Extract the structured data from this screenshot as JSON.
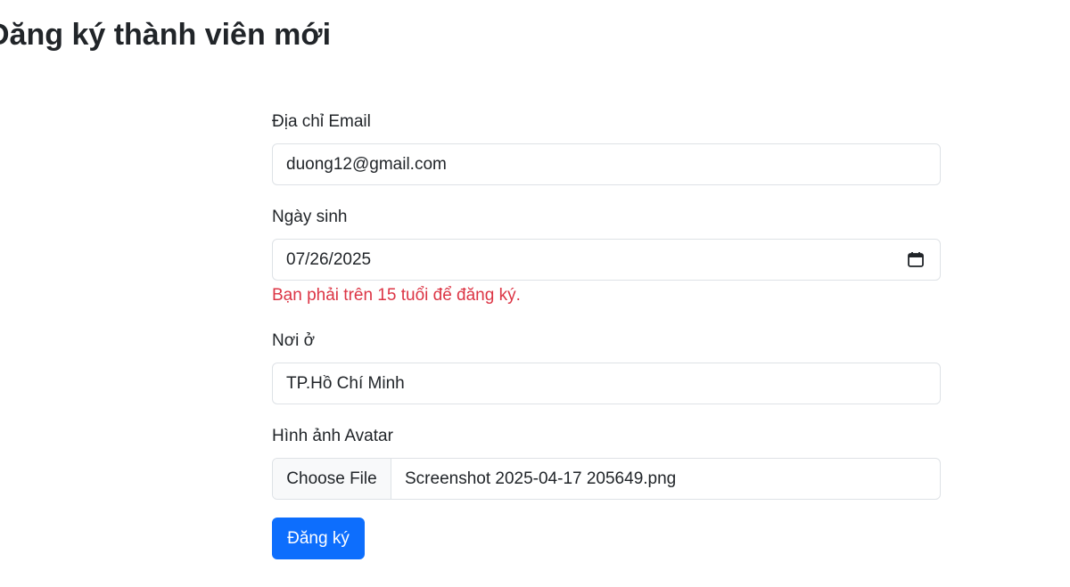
{
  "page": {
    "title": "Đăng ký thành viên mới"
  },
  "form": {
    "email": {
      "label": "Địa chỉ Email",
      "value": "duong12@gmail.com"
    },
    "dob": {
      "label": "Ngày sinh",
      "value": "07/26/2025",
      "icon": "calendar-icon",
      "error": "Bạn phải trên 15 tuổi để đăng ký."
    },
    "address": {
      "label": "Nơi ở",
      "value": "TP.Hồ Chí Minh"
    },
    "avatar": {
      "label": "Hình ảnh Avatar",
      "button_label": "Choose File",
      "file_name": "Screenshot 2025-04-17 205649.png"
    },
    "submit_label": "Đăng ký"
  },
  "colors": {
    "primary": "#0d6efd",
    "error": "#dc3545",
    "border": "#dee2e6"
  }
}
